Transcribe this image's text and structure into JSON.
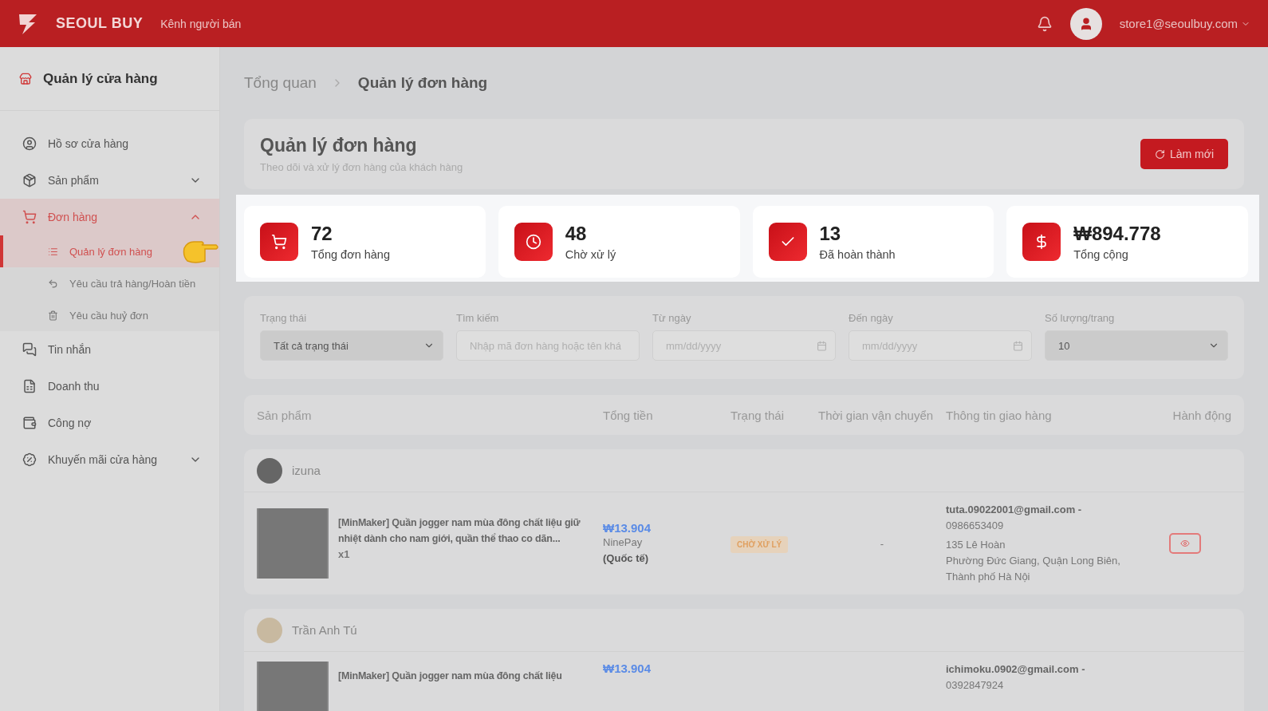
{
  "header": {
    "brand": "SEOUL BUY",
    "channel": "Kênh người bán",
    "account": "store1@seoulbuy.com"
  },
  "sidebar": {
    "title": "Quản lý cửa hàng",
    "items": [
      {
        "label": "Hồ sơ cửa hàng",
        "selected": false
      },
      {
        "label": "Sản phẩm",
        "selected": false,
        "expanded": false
      },
      {
        "label": "Đơn hàng",
        "selected": true,
        "expanded": true,
        "children": [
          {
            "label": "Quản lý đơn hàng",
            "selected": true
          },
          {
            "label": "Yêu cầu trả hàng/Hoàn tiền",
            "selected": false
          },
          {
            "label": "Yêu cầu huỷ đơn",
            "selected": false
          }
        ]
      },
      {
        "label": "Tin nhắn",
        "selected": false
      },
      {
        "label": "Doanh thu",
        "selected": false
      },
      {
        "label": "Công nợ",
        "selected": false
      },
      {
        "label": "Khuyến mãi cửa hàng",
        "selected": false,
        "expanded": false
      }
    ]
  },
  "breadcrumb": [
    {
      "label": "Tổng quan",
      "selected": false
    },
    {
      "label": "Quản lý đơn hàng",
      "selected": true
    }
  ],
  "page": {
    "title": "Quản lý đơn hàng",
    "subtitle": "Theo dõi và xử lý đơn hàng của khách hàng",
    "refresh_button": "Làm mới"
  },
  "stats": [
    {
      "kind": "cart",
      "value": "72",
      "label": "Tổng đơn hàng"
    },
    {
      "kind": "clock",
      "value": "48",
      "label": "Chờ xử lý"
    },
    {
      "kind": "check",
      "value": "13",
      "label": "Đã hoàn thành"
    },
    {
      "kind": "money",
      "value": "₩894.778",
      "label": "Tổng cộng"
    }
  ],
  "filters": [
    {
      "kind": "select",
      "label": "Trạng thái",
      "value": "Tất cả trạng thái"
    },
    {
      "kind": "text",
      "label": "Tìm kiếm",
      "placeholder": "Nhập mã đơn hàng hoặc tên khá"
    },
    {
      "kind": "date",
      "label": "Từ ngày",
      "placeholder": "mm/dd/yyyy"
    },
    {
      "kind": "date",
      "label": "Đến ngày",
      "placeholder": "mm/dd/yyyy"
    },
    {
      "kind": "select",
      "label": "Số lượng/trang",
      "value": "10"
    }
  ],
  "table": {
    "columns": [
      "Sản phẩm",
      "Tổng tiền",
      "Trạng thái",
      "Thời gian vận chuyển",
      "Thông tin giao hàng",
      "Hành động"
    ],
    "orders": [
      {
        "customer": "izuna",
        "product": "[MinMaker] Quần jogger nam mùa đông chất liệu giữ nhiệt dành cho nam giới, quần thể thao co dãn...",
        "quantity": "x1",
        "total": "₩13.904",
        "payment": "NinePay",
        "payment_note": "(Quốc tế)",
        "status": "CHỜ XỬ LÝ",
        "shipping_time": "-",
        "email": "tuta.09022001@gmail.com -",
        "phone": "0986653409",
        "address_line": "135 Lê Hoàn",
        "address_area": "Phường Đức Giang, Quận Long Biên, Thành phố Hà Nội"
      },
      {
        "customer": "Trần Anh Tú",
        "product": "[MinMaker] Quần jogger nam mùa đông chất liệu",
        "total": "₩13.904",
        "email": "ichimoku.0902@gmail.com -",
        "phone": "0392847924"
      }
    ]
  }
}
